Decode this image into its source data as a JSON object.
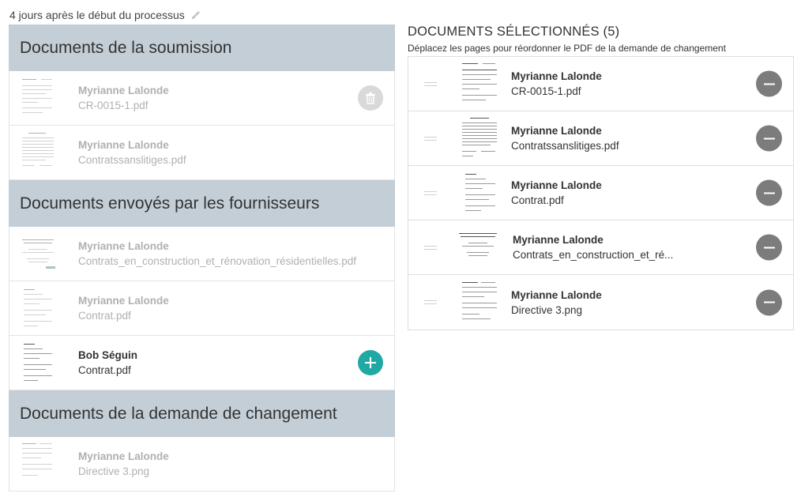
{
  "timing_label": "4 jours après le début du processus",
  "left": {
    "sections": [
      {
        "title": "Documents de la soumission",
        "docs": [
          {
            "author": "Myrianne Lalonde",
            "file": "CR-0015-1.pdf",
            "state": "dim",
            "action": "trash"
          },
          {
            "author": "Myrianne Lalonde",
            "file": "Contratssanslitiges.pdf",
            "state": "dim",
            "action": "none"
          }
        ]
      },
      {
        "title": "Documents envoyés par les fournisseurs",
        "docs": [
          {
            "author": "Myrianne Lalonde",
            "file": "Contrats_en_construction_et_rénovation_résidentielles.pdf",
            "state": "dim",
            "action": "none"
          },
          {
            "author": "Myrianne Lalonde",
            "file": "Contrat.pdf",
            "state": "dim",
            "action": "none"
          },
          {
            "author": "Bob Séguin",
            "file": "Contrat.pdf",
            "state": "active",
            "action": "add"
          }
        ]
      },
      {
        "title": "Documents de la demande de changement",
        "docs": [
          {
            "author": "Myrianne Lalonde",
            "file": "Directive 3.png",
            "state": "dim",
            "action": "none"
          }
        ]
      }
    ]
  },
  "right": {
    "title": "DOCUMENTS SÉLECTIONNÉS (5)",
    "subtitle": "Déplacez les pages pour réordonner le PDF de la demande de changement",
    "selected": [
      {
        "author": "Myrianne Lalonde",
        "file": "CR-0015-1.pdf"
      },
      {
        "author": "Myrianne Lalonde",
        "file": "Contratssanslitiges.pdf"
      },
      {
        "author": "Myrianne Lalonde",
        "file": "Contrat.pdf"
      },
      {
        "author": "Myrianne Lalonde",
        "file": "Contrats_en_construction_et_ré..."
      },
      {
        "author": "Myrianne Lalonde",
        "file": "Directive 3.png"
      }
    ]
  },
  "colors": {
    "section_header_bg": "#c3ced6",
    "add_button": "#20a9a4",
    "remove_button": "#7c7c7c",
    "trash_button": "#d9d9d9"
  },
  "icons": {
    "timing_edit": "pencil-icon",
    "trash": "trash-icon",
    "add": "plus-icon",
    "remove": "minus-icon",
    "drag": "drag-handle-icon"
  }
}
